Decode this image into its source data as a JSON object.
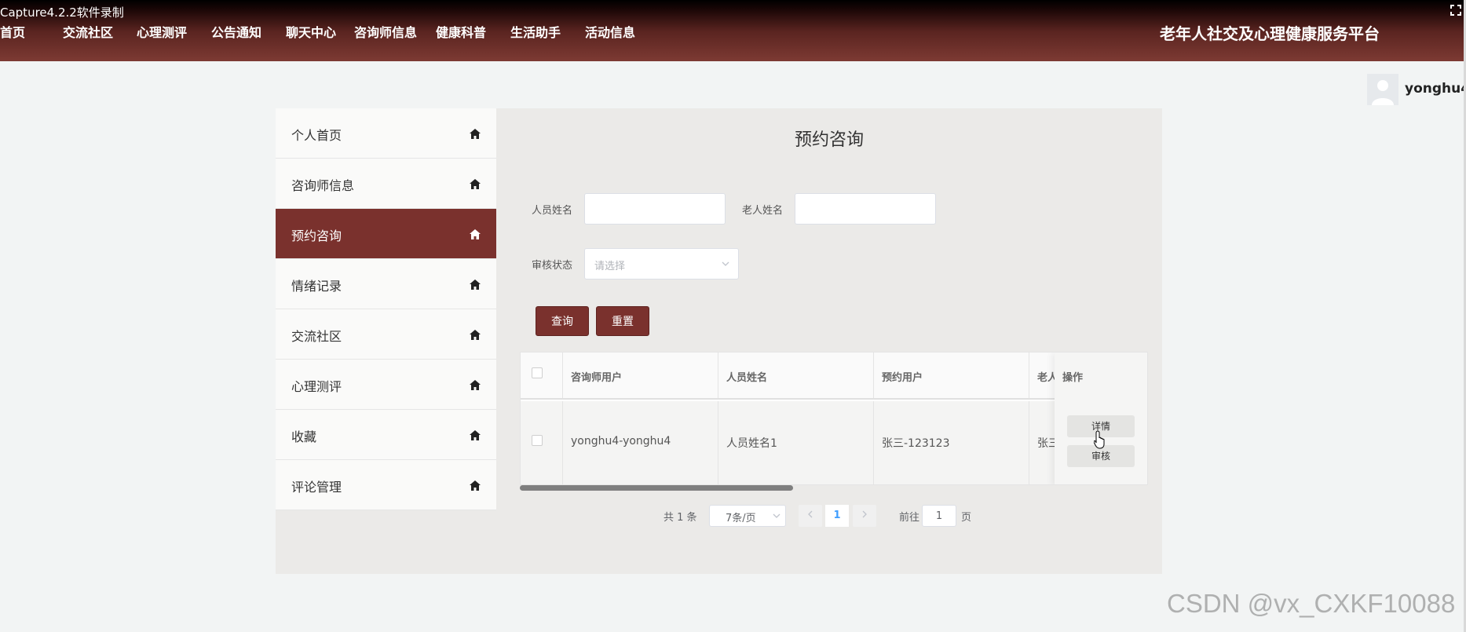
{
  "window": {
    "title": "Capture4.2.2软件录制"
  },
  "nav": {
    "items": [
      "首页",
      "交流社区",
      "心理测评",
      "公告通知",
      "聊天中心",
      "咨询师信息",
      "健康科普",
      "生活助手",
      "活动信息"
    ],
    "site_title": "老年人社交及心理健康服务平台"
  },
  "user": {
    "name": "yonghu4"
  },
  "sidebar": {
    "items": [
      {
        "label": "个人首页",
        "icon": "home-icon"
      },
      {
        "label": "咨询师信息",
        "icon": "home-icon"
      },
      {
        "label": "预约咨询",
        "icon": "home-icon",
        "active": true
      },
      {
        "label": "情绪记录",
        "icon": "home-icon"
      },
      {
        "label": "交流社区",
        "icon": "home-icon"
      },
      {
        "label": "心理测评",
        "icon": "home-icon"
      },
      {
        "label": "收藏",
        "icon": "home-icon"
      },
      {
        "label": "评论管理",
        "icon": "home-icon"
      }
    ]
  },
  "main": {
    "title": "预约咨询",
    "search": {
      "person_name_label": "人员姓名",
      "person_name_value": "",
      "elder_name_label": "老人姓名",
      "elder_name_value": "",
      "status_label": "审核状态",
      "status_placeholder": "请选择",
      "query_button": "查询",
      "reset_button": "重置"
    },
    "table": {
      "columns": [
        "咨询师用户",
        "人员姓名",
        "预约用户",
        "老人"
      ],
      "op_column": "操作",
      "rows": [
        {
          "cells": [
            "yonghu4-yonghu4",
            "人员姓名1",
            "张三-123123",
            "张三"
          ],
          "actions": [
            "详情",
            "审核"
          ]
        }
      ]
    },
    "pagination": {
      "total_text": "共 1 条",
      "page_size": "7条/页",
      "current_page": "1",
      "goto_label": "前往",
      "goto_value": "1",
      "page_suffix": "页"
    }
  },
  "watermark": "CSDN @vx_CXKF10088",
  "colors": {
    "primary": "#7a312d",
    "accent_blue": "#409eff",
    "background": "#f2f4f4"
  }
}
